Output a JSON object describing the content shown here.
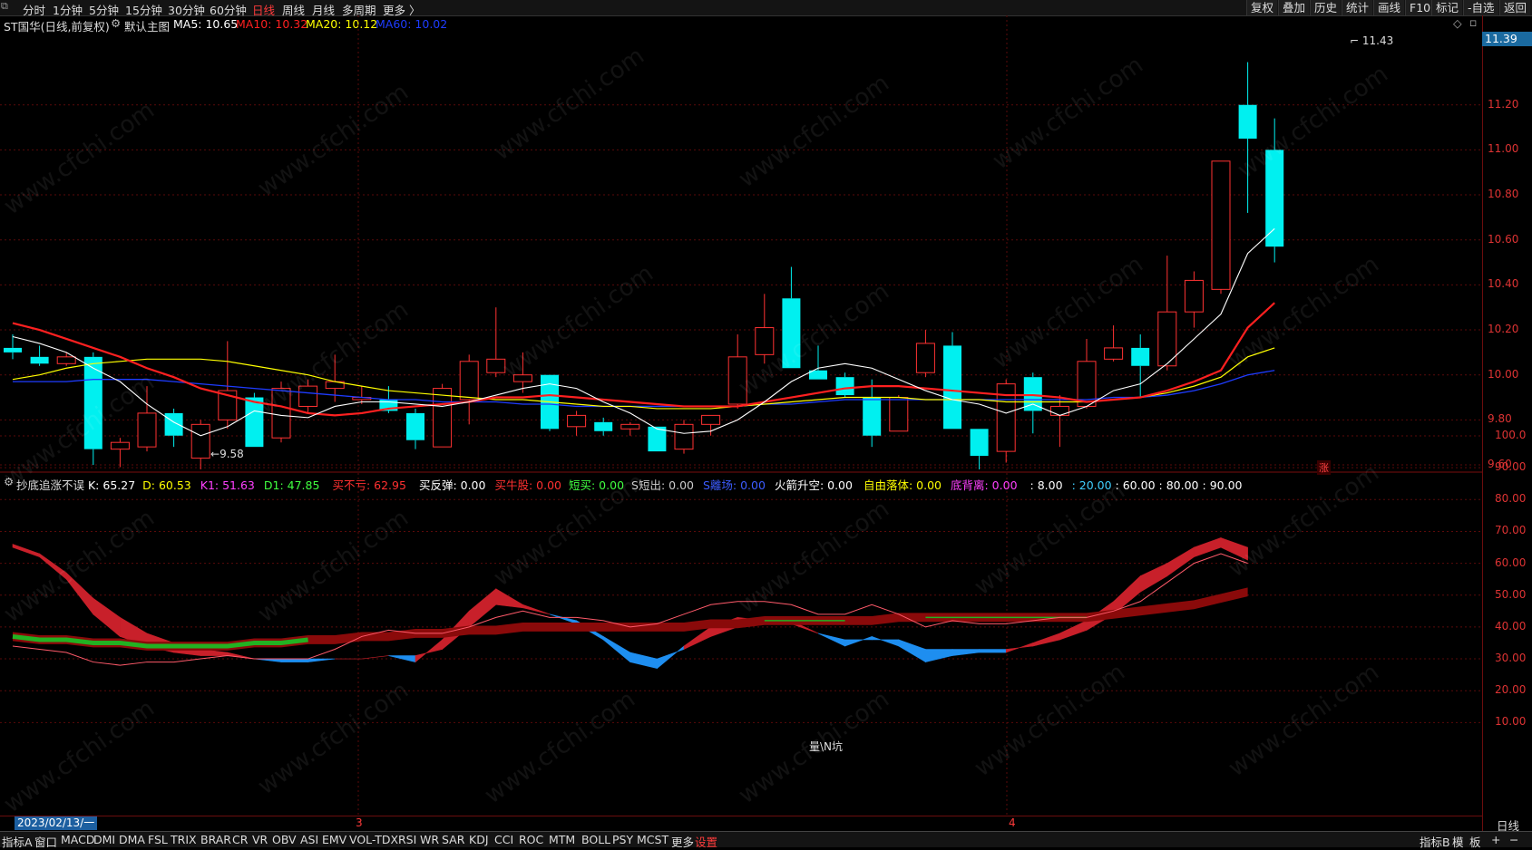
{
  "toolbar": {
    "periods": [
      "分时",
      "1分钟",
      "5分钟",
      "15分钟",
      "30分钟",
      "60分钟",
      "日线",
      "周线",
      "月线",
      "多周期",
      "更多 〉"
    ],
    "active_period": "日线",
    "right_buttons": [
      "复权",
      "叠加",
      "历史",
      "统计",
      "画线",
      "F10",
      "标记",
      "-自选",
      "返回"
    ]
  },
  "main_chart": {
    "stock_label": "ST国华(日线,前复权)",
    "mode_label": "默认主图",
    "ma": [
      {
        "name": "MA5",
        "text": "MA5: 10.65",
        "color": "#ffffff"
      },
      {
        "name": "MA10",
        "text": "MA10: 10.32",
        "color": "#ff2020"
      },
      {
        "name": "MA20",
        "text": "MA20: 10.12",
        "color": "#ffff00"
      },
      {
        "name": "MA60",
        "text": "MA60: 10.02",
        "color": "#1e3cff"
      }
    ],
    "current_price": "11.39",
    "high_marker": "11.43",
    "low_marker": "9.58",
    "badge": "涨",
    "price_ticks": [
      "11.20",
      "11.00",
      "10.80",
      "10.60",
      "10.40",
      "10.20",
      "10.00",
      "9.80",
      "9.60"
    ]
  },
  "indicator": {
    "name": "抄底追涨不误",
    "items": [
      {
        "text": "K: 65.27",
        "color": "#ffffff"
      },
      {
        "text": "D: 60.53",
        "color": "#ffff00"
      },
      {
        "text": "K1: 51.63",
        "color": "#ff40ff"
      },
      {
        "text": "D1: 47.85",
        "color": "#40ff40"
      },
      {
        "text": "买不亏: 62.95",
        "color": "#ff3030"
      },
      {
        "text": "买反弹: 0.00",
        "color": "#ffffff"
      },
      {
        "text": "买牛股: 0.00",
        "color": "#ff3030"
      },
      {
        "text": "短买: 0.00",
        "color": "#40ff40"
      },
      {
        "text": "S短出: 0.00",
        "color": "#cccccc"
      },
      {
        "text": "S離场: 0.00",
        "color": "#3c5cff"
      },
      {
        "text": "火箭升空: 0.00",
        "color": "#ffffff"
      },
      {
        "text": "自由落体: 0.00",
        "color": "#ffff00"
      },
      {
        "text": "底背离: 0.00",
        "color": "#ff40ff"
      },
      {
        "text": ": 8.00",
        "color": "#ffffff"
      },
      {
        "text": ": 20.00",
        "color": "#40d0ff"
      },
      {
        "text": ": 60.00",
        "color": "#ffffff"
      },
      {
        "text": ": 80.00",
        "color": "#ffffff"
      },
      {
        "text": ": 90.00",
        "color": "#ffffff"
      }
    ],
    "ticks": [
      "100.0",
      "90.00",
      "80.00",
      "70.00",
      "60.00",
      "50.00",
      "40.00",
      "30.00",
      "20.00",
      "10.00"
    ],
    "note": "量\\N坑"
  },
  "dates": {
    "selected": "2023/02/13/一",
    "month_marks": [
      "3",
      "4"
    ],
    "period": "日线"
  },
  "bottom_tabs": [
    "指标A",
    "窗口",
    "MACD",
    "DMI",
    "DMA",
    "FSL",
    "TRIX",
    "BRAR",
    "CR",
    "VR",
    "OBV",
    "ASI",
    "EMV",
    "VOL-TDX",
    "RSI",
    "WR",
    "SAR",
    "KDJ",
    "CCI",
    "ROC",
    "MTM",
    "BOLL",
    "PSY",
    "MCST",
    "更多",
    "设置"
  ],
  "bottom_right": [
    "指标B",
    "模",
    "板",
    "+",
    "−"
  ],
  "watermark": "www.cfchi.com",
  "chart_data": {
    "type": "candlestick",
    "title": "ST国华(日线,前复权)",
    "ylim": [
      9.5,
      11.5
    ],
    "candles": [
      {
        "o": 10.12,
        "h": 10.18,
        "l": 10.07,
        "c": 10.1
      },
      {
        "o": 10.08,
        "h": 10.13,
        "l": 10.04,
        "c": 10.05
      },
      {
        "o": 10.05,
        "h": 10.1,
        "l": 10.04,
        "c": 10.08
      },
      {
        "o": 10.08,
        "h": 10.1,
        "l": 9.6,
        "c": 9.67
      },
      {
        "o": 9.67,
        "h": 9.72,
        "l": 9.59,
        "c": 9.7
      },
      {
        "o": 9.68,
        "h": 9.95,
        "l": 9.66,
        "c": 9.83
      },
      {
        "o": 9.83,
        "h": 9.85,
        "l": 9.68,
        "c": 9.73
      },
      {
        "o": 9.63,
        "h": 9.8,
        "l": 9.58,
        "c": 9.78
      },
      {
        "o": 9.8,
        "h": 10.15,
        "l": 9.76,
        "c": 9.93
      },
      {
        "o": 9.9,
        "h": 9.92,
        "l": 9.68,
        "c": 9.68
      },
      {
        "o": 9.72,
        "h": 9.97,
        "l": 9.7,
        "c": 9.94
      },
      {
        "o": 9.86,
        "h": 9.98,
        "l": 9.83,
        "c": 9.95
      },
      {
        "o": 9.94,
        "h": 10.09,
        "l": 9.88,
        "c": 9.97
      },
      {
        "o": 9.89,
        "h": 9.95,
        "l": 9.87,
        "c": 9.9
      },
      {
        "o": 9.89,
        "h": 9.95,
        "l": 9.83,
        "c": 9.84
      },
      {
        "o": 9.83,
        "h": 9.85,
        "l": 9.67,
        "c": 9.71
      },
      {
        "o": 9.68,
        "h": 9.96,
        "l": 9.68,
        "c": 9.94
      },
      {
        "o": 9.89,
        "h": 10.09,
        "l": 9.78,
        "c": 10.06
      },
      {
        "o": 10.01,
        "h": 10.3,
        "l": 9.99,
        "c": 10.07
      },
      {
        "o": 9.97,
        "h": 10.1,
        "l": 9.92,
        "c": 10.0
      },
      {
        "o": 10.0,
        "h": 10.0,
        "l": 9.75,
        "c": 9.76
      },
      {
        "o": 9.77,
        "h": 9.84,
        "l": 9.73,
        "c": 9.82
      },
      {
        "o": 9.79,
        "h": 9.81,
        "l": 9.73,
        "c": 9.75
      },
      {
        "o": 9.76,
        "h": 9.79,
        "l": 9.73,
        "c": 9.78
      },
      {
        "o": 9.77,
        "h": 9.77,
        "l": 9.66,
        "c": 9.66
      },
      {
        "o": 9.67,
        "h": 9.8,
        "l": 9.65,
        "c": 9.78
      },
      {
        "o": 9.78,
        "h": 9.82,
        "l": 9.73,
        "c": 9.82
      },
      {
        "o": 9.87,
        "h": 10.18,
        "l": 9.85,
        "c": 10.08
      },
      {
        "o": 10.09,
        "h": 10.36,
        "l": 10.05,
        "c": 10.21
      },
      {
        "o": 10.34,
        "h": 10.48,
        "l": 10.03,
        "c": 10.03
      },
      {
        "o": 10.02,
        "h": 10.13,
        "l": 9.98,
        "c": 9.98
      },
      {
        "o": 9.99,
        "h": 10.01,
        "l": 9.9,
        "c": 9.91
      },
      {
        "o": 9.9,
        "h": 9.98,
        "l": 9.68,
        "c": 9.73
      },
      {
        "o": 9.75,
        "h": 9.91,
        "l": 9.75,
        "c": 9.9
      },
      {
        "o": 10.01,
        "h": 10.2,
        "l": 9.99,
        "c": 10.14
      },
      {
        "o": 10.13,
        "h": 10.19,
        "l": 9.76,
        "c": 9.76
      },
      {
        "o": 9.76,
        "h": 9.76,
        "l": 9.58,
        "c": 9.64
      },
      {
        "o": 9.66,
        "h": 9.98,
        "l": 9.61,
        "c": 9.96
      },
      {
        "o": 9.99,
        "h": 10.01,
        "l": 9.74,
        "c": 9.84
      },
      {
        "o": 9.82,
        "h": 9.91,
        "l": 9.68,
        "c": 9.86
      },
      {
        "o": 9.86,
        "h": 10.16,
        "l": 9.85,
        "c": 10.06
      },
      {
        "o": 10.07,
        "h": 10.22,
        "l": 10.06,
        "c": 10.12
      },
      {
        "o": 10.12,
        "h": 10.18,
        "l": 9.9,
        "c": 10.04
      },
      {
        "o": 10.04,
        "h": 10.53,
        "l": 10.02,
        "c": 10.28
      },
      {
        "o": 10.28,
        "h": 10.46,
        "l": 10.21,
        "c": 10.42
      },
      {
        "o": 10.38,
        "h": 10.95,
        "l": 10.36,
        "c": 10.95
      },
      {
        "o": 11.2,
        "h": 11.39,
        "l": 10.72,
        "c": 11.05
      },
      {
        "o": 11.0,
        "h": 11.14,
        "l": 10.5,
        "c": 10.57
      }
    ],
    "ma5": [
      10.17,
      10.14,
      10.1,
      10.03,
      9.97,
      9.87,
      9.79,
      9.73,
      9.77,
      9.84,
      9.82,
      9.81,
      9.86,
      9.88,
      9.88,
      9.87,
      9.86,
      9.88,
      9.91,
      9.94,
      9.96,
      9.94,
      9.88,
      9.83,
      9.76,
      9.74,
      9.75,
      9.8,
      9.88,
      9.97,
      10.03,
      10.05,
      10.03,
      9.98,
      9.93,
      9.89,
      9.87,
      9.83,
      9.87,
      9.82,
      9.86,
      9.93,
      9.96,
      10.05,
      10.16,
      10.27,
      10.54,
      10.65
    ],
    "ma10": [
      10.23,
      10.2,
      10.16,
      10.12,
      10.08,
      10.03,
      9.99,
      9.94,
      9.91,
      9.88,
      9.86,
      9.83,
      9.82,
      9.83,
      9.85,
      9.86,
      9.87,
      9.88,
      9.9,
      9.9,
      9.91,
      9.9,
      9.89,
      9.88,
      9.87,
      9.86,
      9.86,
      9.86,
      9.88,
      9.9,
      9.92,
      9.94,
      9.95,
      9.95,
      9.94,
      9.93,
      9.92,
      9.91,
      9.91,
      9.9,
      9.88,
      9.89,
      9.9,
      9.93,
      9.97,
      10.02,
      10.21,
      10.32
    ],
    "ma20": [
      9.98,
      10.0,
      10.03,
      10.05,
      10.06,
      10.07,
      10.07,
      10.07,
      10.06,
      10.04,
      10.02,
      10.0,
      9.97,
      9.95,
      9.93,
      9.92,
      9.91,
      9.9,
      9.89,
      9.89,
      9.88,
      9.87,
      9.86,
      9.86,
      9.85,
      9.85,
      9.85,
      9.86,
      9.87,
      9.88,
      9.89,
      9.9,
      9.9,
      9.9,
      9.89,
      9.89,
      9.89,
      9.88,
      9.88,
      9.88,
      9.88,
      9.89,
      9.9,
      9.92,
      9.95,
      9.99,
      10.08,
      10.12
    ],
    "ma60": [
      9.97,
      9.97,
      9.97,
      9.98,
      9.98,
      9.98,
      9.97,
      9.96,
      9.95,
      9.94,
      9.93,
      9.92,
      9.91,
      9.9,
      9.89,
      9.89,
      9.88,
      9.88,
      9.88,
      9.87,
      9.87,
      9.86,
      9.86,
      9.86,
      9.86,
      9.86,
      9.86,
      9.86,
      9.87,
      9.87,
      9.88,
      9.89,
      9.89,
      9.89,
      9.89,
      9.89,
      9.89,
      9.89,
      9.89,
      9.89,
      9.89,
      9.9,
      9.9,
      9.91,
      9.93,
      9.96,
      10.0,
      10.02
    ],
    "k": [
      66,
      63,
      57,
      49,
      43,
      38,
      35,
      33,
      32,
      30,
      29,
      29,
      30,
      30,
      31,
      29,
      36,
      45,
      52,
      47,
      44,
      41,
      36,
      29,
      27,
      34,
      40,
      43,
      42,
      42,
      38,
      34,
      37,
      34,
      29,
      31,
      32,
      32,
      35,
      38,
      42,
      48,
      56,
      60,
      65,
      68,
      65
    ],
    "d": [
      65,
      62,
      55,
      44,
      37,
      34,
      32,
      31,
      31,
      30,
      30,
      30,
      30,
      30,
      31,
      31,
      33,
      40,
      47,
      46,
      44,
      42,
      37,
      32,
      30,
      33,
      37,
      40,
      41,
      41,
      38,
      36,
      36,
      36,
      33,
      33,
      33,
      33,
      34,
      36,
      39,
      44,
      51,
      56,
      62,
      65,
      61
    ],
    "k_line": [
      34,
      33,
      32,
      29,
      28,
      29,
      29,
      30,
      31,
      30,
      30,
      30,
      33,
      37,
      39,
      38,
      38,
      40,
      43,
      45,
      43,
      43,
      42,
      40,
      41,
      44,
      47,
      48,
      48,
      47,
      44,
      44,
      47,
      44,
      40,
      42,
      41,
      41,
      42,
      43,
      43,
      45,
      48,
      54,
      60,
      63,
      60
    ],
    "d1": [
      37,
      36,
      36,
      35,
      35,
      34,
      34,
      34,
      34,
      35,
      35,
      36,
      36,
      37,
      37,
      38,
      38,
      39,
      39,
      40,
      40,
      40,
      40,
      40,
      40,
      40,
      41,
      41,
      42,
      42,
      42,
      42,
      42,
      43,
      43,
      43,
      43,
      43,
      43,
      43,
      43,
      44,
      45,
      46,
      47,
      49,
      51
    ]
  }
}
